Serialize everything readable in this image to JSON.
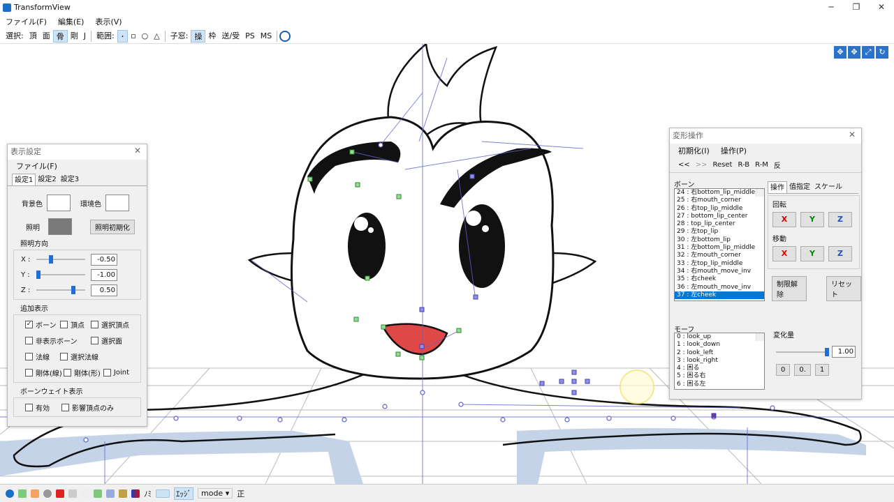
{
  "window": {
    "title": "TransformView",
    "minimize": "─",
    "maximize": "❐",
    "close": "✕"
  },
  "menu": {
    "file": "ファイル(F)",
    "edit": "編集(E)",
    "view": "表示(V)"
  },
  "toolbar": {
    "select_label": "選択:",
    "vertex": "頂",
    "face": "面",
    "bone": "骨",
    "rigid": "剛",
    "joint": "J",
    "range_label": "範囲:",
    "range_point": "･",
    "range_rect": "▫",
    "range_circle": "○",
    "range_tri": "△",
    "child_label": "子窓:",
    "operate": "操",
    "frame": "枠",
    "send_recv": "送/受",
    "ps": "PS",
    "ms": "MS"
  },
  "display_panel": {
    "title": "表示設定",
    "menu_file": "ファイル(F)",
    "tabs": [
      "設定1",
      "設定2",
      "設定3"
    ],
    "bg_color_label": "背景色",
    "env_color_label": "環境色",
    "light_label": "照明",
    "light_reset_button": "照明初期化",
    "light_dir_label": "照明方向",
    "x_label": "X :",
    "y_label": "Y :",
    "z_label": "Z :",
    "x_value": "-0.50",
    "y_value": "-1.00",
    "z_value": "0.50",
    "extra_display_label": "追加表示",
    "cb_bone": "ボーン",
    "cb_vertex": "頂点",
    "cb_selected_vertex": "選択頂点",
    "cb_hidden_bone": "非表示ボーン",
    "cb_selected_face": "選択面",
    "cb_normal": "法線",
    "cb_selected_normal": "選択法線",
    "cb_rigid_line": "剛体(線)",
    "cb_rigid_shape": "剛体(形)",
    "cb_joint": "Joint",
    "weight_label": "ボーンウェイト表示",
    "cb_enabled": "有効",
    "cb_affected_only": "影響頂点のみ"
  },
  "transform_panel": {
    "title": "変形操作",
    "menu_init": "初期化(I)",
    "menu_op": "操作(P)",
    "prev": "<<",
    "next": ">>",
    "reset": "Reset",
    "rb": "R-B",
    "rm": "R-M",
    "flip": "反",
    "bone_label": "ボーン",
    "bones": [
      "24 : 右bottom_lip_middle",
      "25 : 右mouth_corner",
      "26 : 右top_lip_middle",
      "27 : bottom_lip_center",
      "28 : top_lip_center",
      "29 : 左top_lip",
      "30 : 左bottom_lip",
      "31 : 左bottom_lip_middle",
      "32 : 左mouth_corner",
      "33 : 左top_lip_middle",
      "34 : 右mouth_move_inv",
      "35 : 右cheek",
      "36 : 左mouth_move_inv",
      "37 : 左cheek"
    ],
    "tabs": [
      "操作",
      "值指定",
      "スケール"
    ],
    "rotate_label": "回転",
    "move_label": "移動",
    "x": "X",
    "y": "Y",
    "z": "Z",
    "limit_release": "制限解除",
    "reset_btn": "リセット",
    "morph_label": "モーフ",
    "morphs": [
      "0 : look_up",
      "1 : look_down",
      "2 : look_left",
      "3 : look_right",
      "4 : 困る",
      "5 : 困る右",
      "6 : 困る左"
    ],
    "change_label": "変化量",
    "change_value": "1.00",
    "b0": "0",
    "b0dot": "0.",
    "b1": "1"
  },
  "statusbar": {
    "nomi": "ﾉﾐ",
    "mode": "mode",
    "sei": "正",
    "edge": "ｴｯｼﾞ"
  }
}
